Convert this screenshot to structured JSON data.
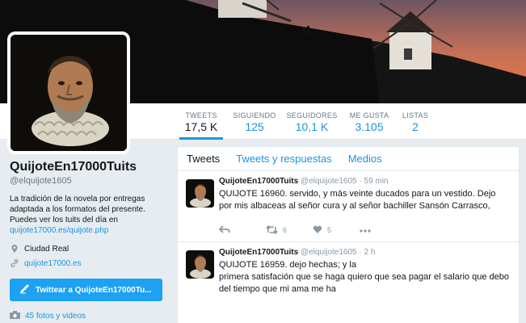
{
  "profile": {
    "name": "QuijoteEn17000Tuits",
    "handle": "@elquijote1605",
    "bio_text": "La tradición de la novela por entregas adaptada a los formatos del presente. Puedes ver los tuits del día en",
    "bio_link": "quijote17000.es/quijote.php",
    "location": "Ciudad Real",
    "website": "quijote17000.es",
    "tweet_to_label": "Twittear a QuijoteEn17000Tu...",
    "photos_label": "45 fotos y videos"
  },
  "stats": [
    {
      "label": "TWEETS",
      "value": "17,5 K"
    },
    {
      "label": "SIGUIENDO",
      "value": "125"
    },
    {
      "label": "SEGUIDORES",
      "value": "10,1 K"
    },
    {
      "label": "ME GUSTA",
      "value": "3.105"
    },
    {
      "label": "LISTAS",
      "value": "2"
    }
  ],
  "tabs": [
    {
      "label": "Tweets"
    },
    {
      "label": "Tweets y respuestas"
    },
    {
      "label": "Medios"
    }
  ],
  "tweets": [
    {
      "name": "QuijoteEn17000Tuits",
      "handle": "@elquijote1605",
      "sep": "·",
      "time": "59 min",
      "text": "QUIJOTE 16960. servido, y más veinte ducados para un vestido. Dejo por mis albaceas al señor cura y al señor bachiller Sansón Carrasco,",
      "retweets": "6",
      "likes": "5"
    },
    {
      "name": "QuijoteEn17000Tuits",
      "handle": "@elquijote1605",
      "sep": "·",
      "time": "2 h",
      "line1": "QUIJOTE 16959. dejo hechas; y la",
      "line2": "primera satisfación que se haga quiero que sea pagar el salario que debo",
      "line3": "del tiempo que mi ama me ha"
    }
  ],
  "colors": {
    "accent": "#1b95e0",
    "button": "#1da1f2",
    "background": "#e6ecf0"
  }
}
